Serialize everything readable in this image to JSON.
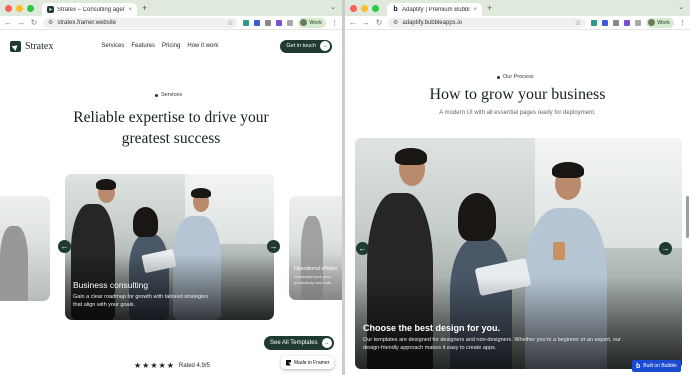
{
  "left_window": {
    "tab": {
      "title": "Stratex – Consulting agency",
      "close": "×"
    },
    "new_tab": "+",
    "address": "stratex.framer.website",
    "profile": "Work",
    "site": {
      "brand": "Stratex",
      "nav": [
        "Services",
        "Features",
        "Pricing",
        "How it work"
      ],
      "cta": "Get in touch",
      "eyebrow": "Services",
      "hero_line1": "Reliable expertise to drive your",
      "hero_line2": "greatest success",
      "active_card": {
        "title": "Business consulting",
        "desc_line1": "Gain a clear roadmap for growth with tailored strategies",
        "desc_line2": "that align with your goals."
      },
      "next_card": {
        "title": "Operational efficien",
        "desc_line1": "Streamline your proc",
        "desc_line2": "productivity and redu"
      },
      "see_all": "See All Templates",
      "rating_stars": "★★★★★",
      "rating_text": "Rated 4.9/5",
      "framer_badge": "Made in Framer"
    }
  },
  "right_window": {
    "tab": {
      "title": "Adaptify | Premium Bubble T",
      "close": "×"
    },
    "new_tab": "+",
    "address": "adaptify.bubbleapps.io",
    "profile": "Work",
    "site": {
      "eyebrow": "Our Process",
      "title": "How to grow your business",
      "subtitle": "A modern UI with all essential pages ready for deployment.",
      "card_title": "Choose the best design for you.",
      "card_desc_line1": "Our templates are designed for designers and non-designers. Whether you're a beginner or an expert, our",
      "card_desc_line2": "design-friendly approach makes it easy to create apps.",
      "bubble_badge": "Built on Bubble",
      "bubble_logo": "b"
    }
  },
  "icons": {
    "back": "←",
    "forward": "→",
    "reload": "↻",
    "prev": "←",
    "next": "→",
    "star": "☆",
    "menu": "⋮",
    "chevron": "⌄"
  },
  "colors": {
    "brand_dark_green": "#1f3b2f",
    "bubble_blue": "#1b4bd1",
    "tabbar": "#dfe9dc"
  }
}
